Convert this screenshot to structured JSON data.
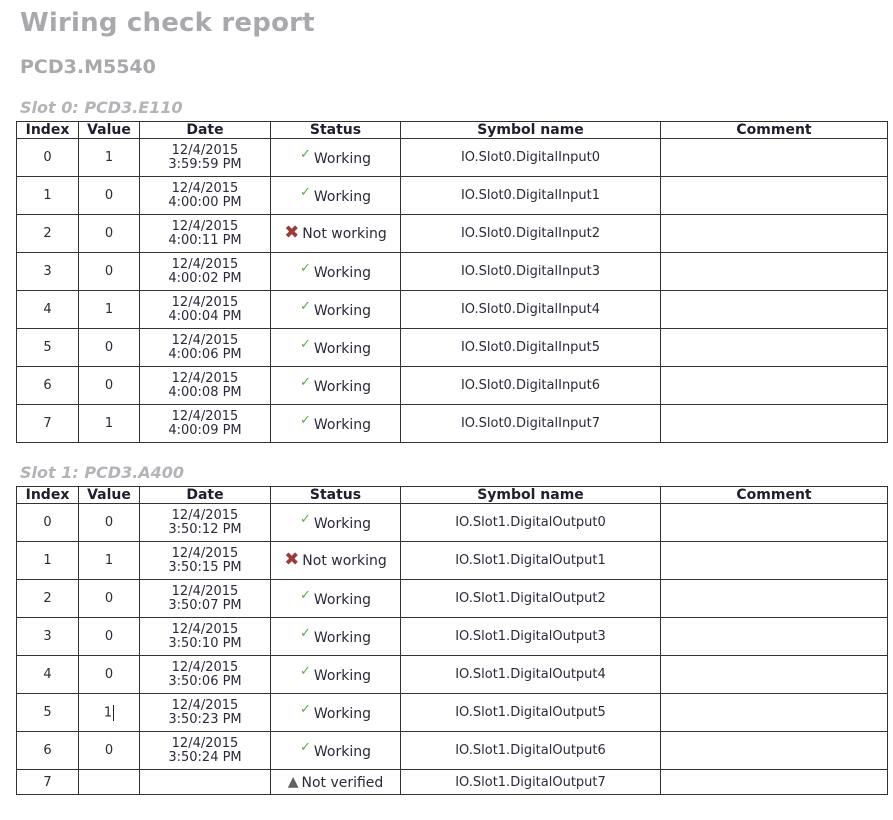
{
  "title": "Wiring check report",
  "device": "PCD3.M5540",
  "columns": [
    "Index",
    "Value",
    "Date",
    "Status",
    "Symbol name",
    "Comment"
  ],
  "status_icons": {
    "Working": "check-icon",
    "Not working": "cross-icon",
    "Not verified": "warning-icon"
  },
  "colors": {
    "heading": "#a8a8ad",
    "check": "#5aa84a",
    "cross": "#9a3b3b",
    "warning": "#606066"
  },
  "slots": [
    {
      "heading": "Slot 0: PCD3.E110",
      "rows": [
        {
          "index": "0",
          "value": "1",
          "date": "12/4/2015",
          "time": "3:59:59 PM",
          "status": "Working",
          "icon": "check",
          "symbol": "IO.Slot0.DigitalInput0",
          "comment": ""
        },
        {
          "index": "1",
          "value": "0",
          "date": "12/4/2015",
          "time": "4:00:00 PM",
          "status": "Working",
          "icon": "check",
          "symbol": "IO.Slot0.DigitalInput1",
          "comment": ""
        },
        {
          "index": "2",
          "value": "0",
          "date": "12/4/2015",
          "time": "4:00:11 PM",
          "status": "Not working",
          "icon": "cross",
          "symbol": "IO.Slot0.DigitalInput2",
          "comment": ""
        },
        {
          "index": "3",
          "value": "0",
          "date": "12/4/2015",
          "time": "4:00:02 PM",
          "status": "Working",
          "icon": "check",
          "symbol": "IO.Slot0.DigitalInput3",
          "comment": ""
        },
        {
          "index": "4",
          "value": "1",
          "date": "12/4/2015",
          "time": "4:00:04 PM",
          "status": "Working",
          "icon": "check",
          "symbol": "IO.Slot0.DigitalInput4",
          "comment": ""
        },
        {
          "index": "5",
          "value": "0",
          "date": "12/4/2015",
          "time": "4:00:06 PM",
          "status": "Working",
          "icon": "check",
          "symbol": "IO.Slot0.DigitalInput5",
          "comment": ""
        },
        {
          "index": "6",
          "value": "0",
          "date": "12/4/2015",
          "time": "4:00:08 PM",
          "status": "Working",
          "icon": "check",
          "symbol": "IO.Slot0.DigitalInput6",
          "comment": ""
        },
        {
          "index": "7",
          "value": "1",
          "date": "12/4/2015",
          "time": "4:00:09 PM",
          "status": "Working",
          "icon": "check",
          "symbol": "IO.Slot0.DigitalInput7",
          "comment": ""
        }
      ]
    },
    {
      "heading": "Slot 1: PCD3.A400",
      "rows": [
        {
          "index": "0",
          "value": "0",
          "date": "12/4/2015",
          "time": "3:50:12 PM",
          "status": "Working",
          "icon": "check",
          "symbol": "IO.Slot1.DigitalOutput0",
          "comment": ""
        },
        {
          "index": "1",
          "value": "1",
          "date": "12/4/2015",
          "time": "3:50:15 PM",
          "status": "Not working",
          "icon": "cross",
          "symbol": "IO.Slot1.DigitalOutput1",
          "comment": ""
        },
        {
          "index": "2",
          "value": "0",
          "date": "12/4/2015",
          "time": "3:50:07 PM",
          "status": "Working",
          "icon": "check",
          "symbol": "IO.Slot1.DigitalOutput2",
          "comment": ""
        },
        {
          "index": "3",
          "value": "0",
          "date": "12/4/2015",
          "time": "3:50:10 PM",
          "status": "Working",
          "icon": "check",
          "symbol": "IO.Slot1.DigitalOutput3",
          "comment": ""
        },
        {
          "index": "4",
          "value": "0",
          "date": "12/4/2015",
          "time": "3:50:06 PM",
          "status": "Working",
          "icon": "check",
          "symbol": "IO.Slot1.DigitalOutput4",
          "comment": ""
        },
        {
          "index": "5",
          "value": "1",
          "date": "12/4/2015",
          "time": "3:50:23 PM",
          "status": "Working",
          "icon": "check",
          "symbol": "IO.Slot1.DigitalOutput5",
          "comment": "",
          "editing": true
        },
        {
          "index": "6",
          "value": "0",
          "date": "12/4/2015",
          "time": "3:50:24 PM",
          "status": "Working",
          "icon": "check",
          "symbol": "IO.Slot1.DigitalOutput6",
          "comment": ""
        },
        {
          "index": "7",
          "value": "",
          "date": "",
          "time": "",
          "status": "Not verified",
          "icon": "warn",
          "symbol": "IO.Slot1.DigitalOutput7",
          "comment": ""
        }
      ]
    }
  ]
}
